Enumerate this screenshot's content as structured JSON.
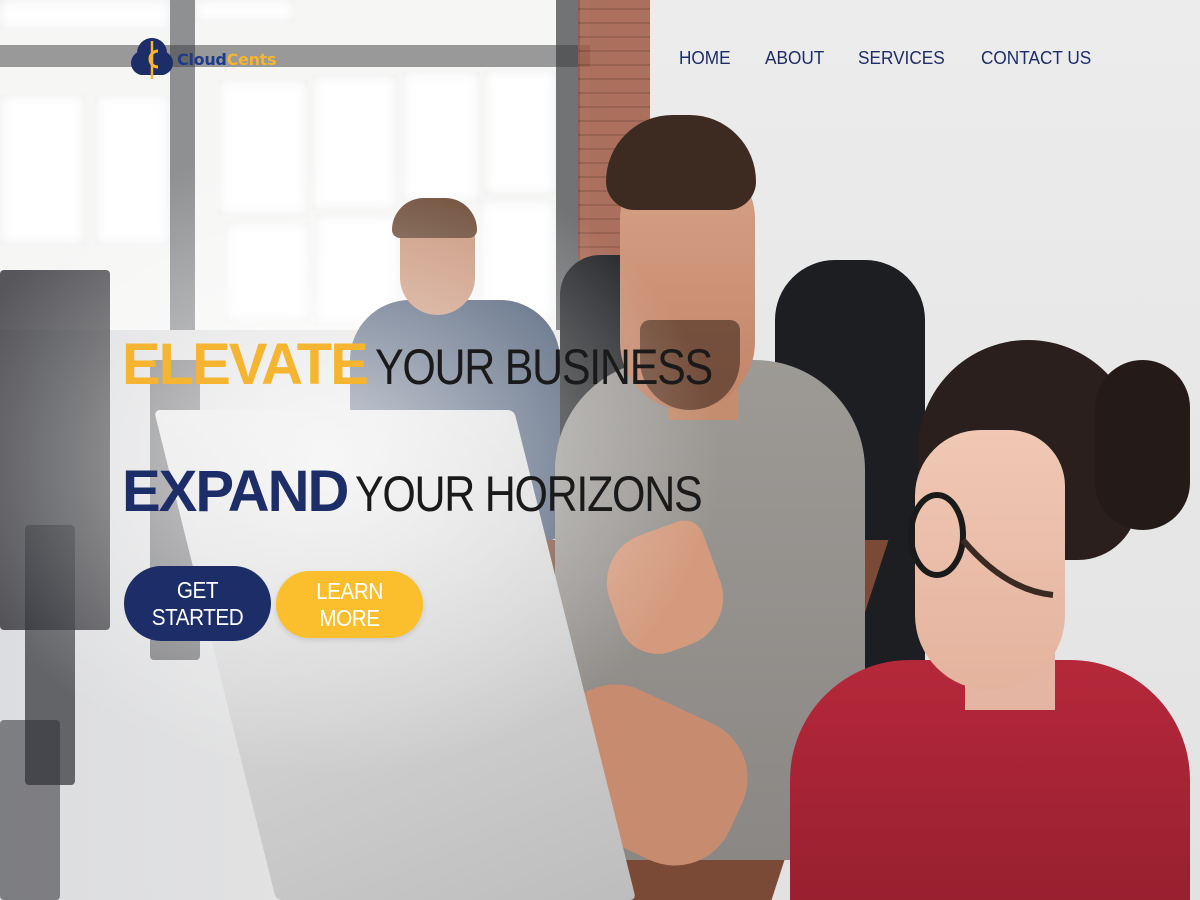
{
  "brand": {
    "name_part1": "Cloud",
    "name_part2": "Cents",
    "logo_icon": "cloud-cent-icon",
    "colors": {
      "navy": "#1d2d67",
      "yellow": "#f5b530"
    }
  },
  "nav": {
    "items": [
      {
        "label": "HOME"
      },
      {
        "label": "ABOUT"
      },
      {
        "label": "SERVICES"
      },
      {
        "label": "CONTACT US"
      }
    ]
  },
  "hero": {
    "line1": {
      "strong": "ELEVATE",
      "rest": "YOUR BUSINESS"
    },
    "line2": {
      "strong": "EXPAND",
      "rest": "YOUR HORIZONS"
    },
    "primary_button": "GET STARTED",
    "secondary_button": "LEARN MORE",
    "background": "office-team-photo"
  }
}
